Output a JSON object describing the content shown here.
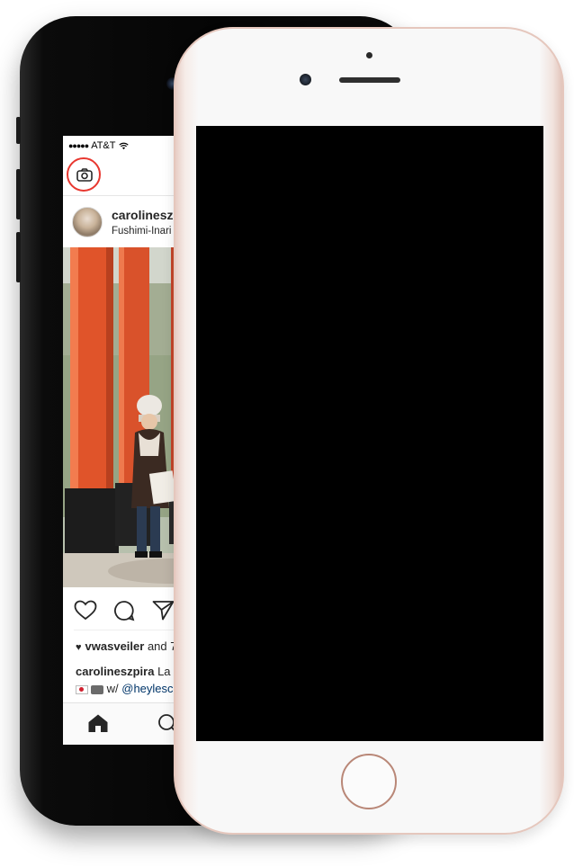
{
  "back_phone": {
    "status_bar": {
      "signal": "●●●●●",
      "carrier": "AT&T"
    },
    "post": {
      "username": "carolineszpira",
      "location": "Fushimi-Inari T",
      "likes_user": "vwasveiler",
      "likes_suffix": "and 7",
      "caption_user": "carolineszpira",
      "caption_text": "La p",
      "caption_prefix": "w/",
      "caption_mention": "@heylesc"
    },
    "icons": {
      "top_left": "camera-icon",
      "actions": [
        "heart-icon",
        "comment-icon",
        "share-icon"
      ],
      "tabs": [
        "home-icon",
        "search-icon"
      ]
    },
    "accent_colors": {
      "highlight_ring": "#e8372f",
      "mention": "#003569",
      "torii_orange": "#e0542a"
    }
  },
  "front_phone": {
    "finish": "rose gold",
    "screen_state": "black"
  }
}
